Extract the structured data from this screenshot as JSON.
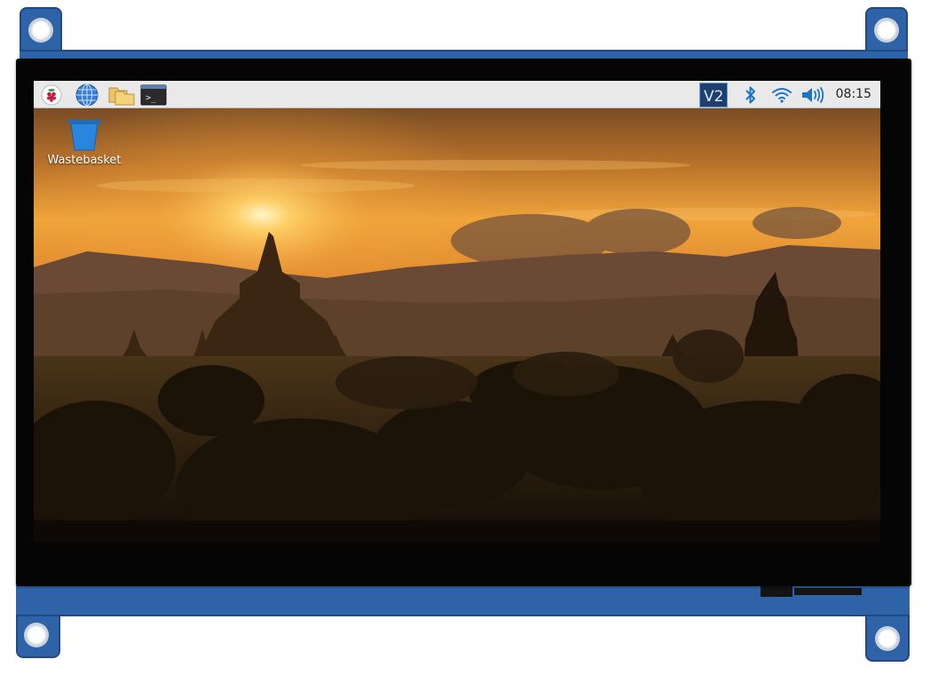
{
  "taskbar": {
    "launchers": [
      {
        "icon": "raspberry-menu-icon"
      },
      {
        "icon": "web-browser-icon"
      },
      {
        "icon": "file-manager-icon"
      },
      {
        "icon": "terminal-icon",
        "glyph": ">_"
      }
    ],
    "tray": {
      "vnc_icon_text": "V2",
      "icons": [
        "vnc-icon",
        "bluetooth-icon",
        "wifi-icon",
        "volume-icon"
      ],
      "clock": "08:15"
    }
  },
  "desktop": {
    "icons": [
      {
        "icon": "wastebasket-icon",
        "label": "Wastebasket"
      }
    ],
    "wallpaper": "sunset-over-temples"
  },
  "colors": {
    "pcb": "#2f63a8",
    "bezel": "#050505",
    "taskbar": "#e9e9e9",
    "accent": "#1a73c9"
  }
}
